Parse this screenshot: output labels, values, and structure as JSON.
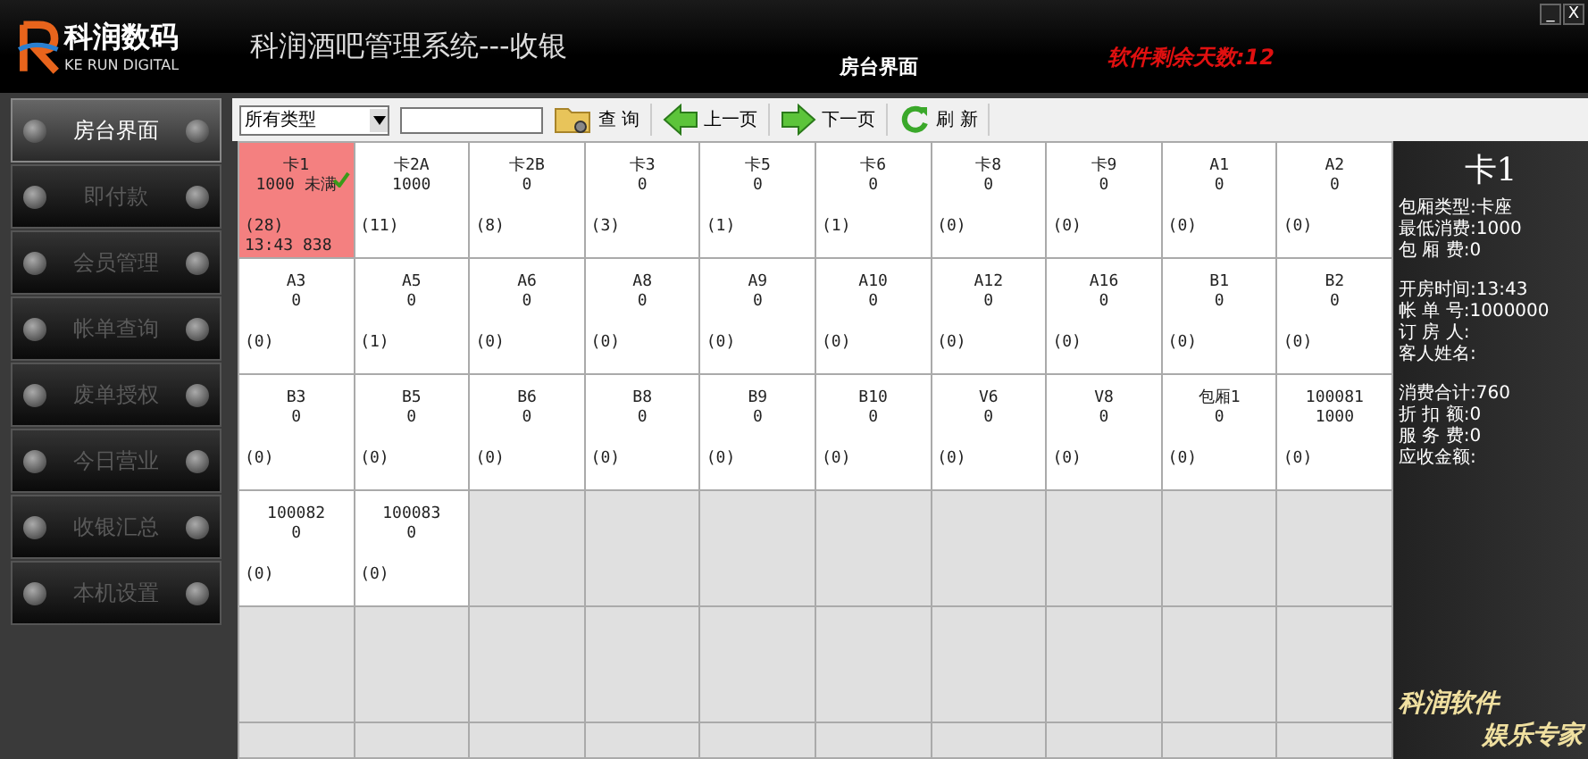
{
  "header": {
    "logo_name": "科润数码",
    "logo_sub": "KE RUN DIGITAL",
    "title": "科润酒吧管理系统---收银",
    "screen": "房台界面",
    "license": "软件剩余天数:12"
  },
  "window_controls": [
    "_",
    "X"
  ],
  "sidebar": {
    "items": [
      {
        "label": "房台界面",
        "selected": true
      },
      {
        "label": "即付款",
        "selected": false
      },
      {
        "label": "会员管理",
        "selected": false
      },
      {
        "label": "帐单查询",
        "selected": false
      },
      {
        "label": "废单授权",
        "selected": false
      },
      {
        "label": "今日营业",
        "selected": false
      },
      {
        "label": "收银汇总",
        "selected": false
      },
      {
        "label": "本机设置",
        "selected": false
      }
    ]
  },
  "toolbar": {
    "type_select": "所有类型",
    "buttons": [
      {
        "kind": "search",
        "label": "查 询"
      },
      {
        "kind": "prev",
        "label": "上一页"
      },
      {
        "kind": "next",
        "label": "下一页"
      },
      {
        "kind": "refresh",
        "label": "刷 新"
      }
    ]
  },
  "rooms": [
    {
      "name": "卡1",
      "amount": "1000 未满",
      "count": "(28)",
      "time": "13:43 838",
      "selected": true,
      "checked": true
    },
    {
      "name": "卡2A",
      "amount": "1000",
      "count": "(11)",
      "selected": false,
      "checked": false
    },
    {
      "name": "卡2B",
      "amount": "0",
      "count": "(8)",
      "selected": false,
      "checked": false
    },
    {
      "name": "卡3",
      "amount": "0",
      "count": "(3)",
      "selected": false,
      "checked": false
    },
    {
      "name": "卡5",
      "amount": "0",
      "count": "(1)",
      "selected": false,
      "checked": false
    },
    {
      "name": "卡6",
      "amount": "0",
      "count": "(1)",
      "selected": false,
      "checked": false
    },
    {
      "name": "卡8",
      "amount": "0",
      "count": "(0)",
      "selected": false,
      "checked": false
    },
    {
      "name": "卡9",
      "amount": "0",
      "count": "(0)",
      "selected": false,
      "checked": false
    },
    {
      "name": "A1",
      "amount": "0",
      "count": "(0)",
      "selected": false,
      "checked": false
    },
    {
      "name": "A2",
      "amount": "0",
      "count": "(0)",
      "selected": false,
      "checked": false
    },
    {
      "name": "A3",
      "amount": "0",
      "count": "(0)",
      "selected": false,
      "checked": false
    },
    {
      "name": "A5",
      "amount": "0",
      "count": "(1)",
      "selected": false,
      "checked": false
    },
    {
      "name": "A6",
      "amount": "0",
      "count": "(0)",
      "selected": false,
      "checked": false
    },
    {
      "name": "A8",
      "amount": "0",
      "count": "(0)",
      "selected": false,
      "checked": false
    },
    {
      "name": "A9",
      "amount": "0",
      "count": "(0)",
      "selected": false,
      "checked": false
    },
    {
      "name": "A10",
      "amount": "0",
      "count": "(0)",
      "selected": false,
      "checked": false
    },
    {
      "name": "A12",
      "amount": "0",
      "count": "(0)",
      "selected": false,
      "checked": false
    },
    {
      "name": "A16",
      "amount": "0",
      "count": "(0)",
      "selected": false,
      "checked": false
    },
    {
      "name": "B1",
      "amount": "0",
      "count": "(0)",
      "selected": false,
      "checked": false
    },
    {
      "name": "B2",
      "amount": "0",
      "count": "(0)",
      "selected": false,
      "checked": false
    },
    {
      "name": "B3",
      "amount": "0",
      "count": "(0)",
      "selected": false,
      "checked": false
    },
    {
      "name": "B5",
      "amount": "0",
      "count": "(0)",
      "selected": false,
      "checked": false
    },
    {
      "name": "B6",
      "amount": "0",
      "count": "(0)",
      "selected": false,
      "checked": false
    },
    {
      "name": "B8",
      "amount": "0",
      "count": "(0)",
      "selected": false,
      "checked": false
    },
    {
      "name": "B9",
      "amount": "0",
      "count": "(0)",
      "selected": false,
      "checked": false
    },
    {
      "name": "B10",
      "amount": "0",
      "count": "(0)",
      "selected": false,
      "checked": false
    },
    {
      "name": "V6",
      "amount": "0",
      "count": "(0)",
      "selected": false,
      "checked": false
    },
    {
      "name": "V8",
      "amount": "0",
      "count": "(0)",
      "selected": false,
      "checked": false
    },
    {
      "name": "包厢1",
      "amount": "0",
      "count": "(0)",
      "selected": false,
      "checked": false
    },
    {
      "name": "100081",
      "amount": "1000",
      "count": "(0)",
      "selected": false,
      "checked": false
    },
    {
      "name": "100082",
      "amount": "0",
      "count": "(0)",
      "selected": false,
      "checked": false
    },
    {
      "name": "100083",
      "amount": "0",
      "count": "(0)",
      "selected": false,
      "checked": false
    }
  ],
  "detail": {
    "title": "卡1",
    "lines_top": [
      "包厢类型:卡座",
      "最低消费:1000",
      "包 厢 费:0"
    ],
    "lines_mid": [
      "开房时间:13:43",
      "帐 单 号:1000000",
      "订 房 人:",
      "客人姓名:"
    ],
    "lines_bottom": [
      "消费合计:760",
      "折 扣 额:0",
      "服 务 费:0",
      "应收金额:"
    ]
  },
  "brand_slogan": [
    "科润软件",
    "娱乐专家"
  ]
}
